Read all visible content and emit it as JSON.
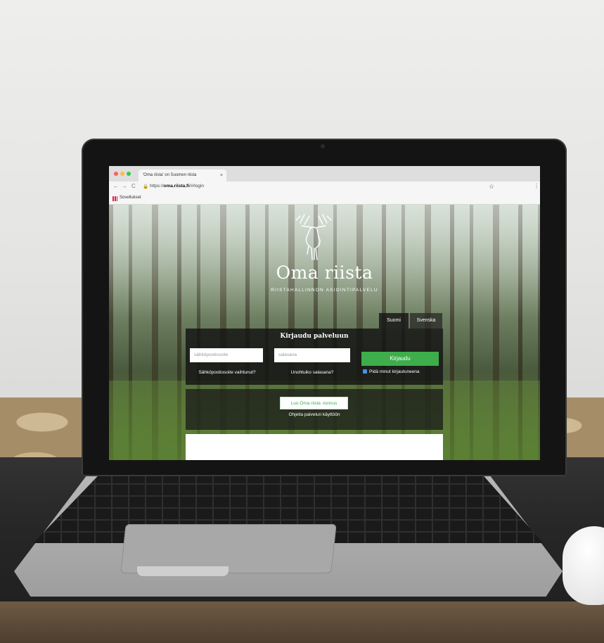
{
  "browser": {
    "tab_title": "'Oma riista' on Suomen riista",
    "tab_close": "×",
    "nav_back": "←",
    "nav_forward": "→",
    "nav_reload": "C",
    "lock": "🔒",
    "url_prefix": "https://",
    "url_domain": "oma.riista.fi",
    "url_path": "/#/login",
    "bookmark_star": "☆",
    "menu": "⋮",
    "bookmarks_label": "Sovellukset"
  },
  "page": {
    "brand": "Oma riista",
    "tagline": "RIISTAHALLINNON ASIOINTIPALVELU",
    "languages": [
      "Suomi",
      "Svenska"
    ],
    "login": {
      "title": "Kirjaudu palveluun",
      "email_placeholder": "sähköpostiosoite",
      "password_placeholder": "salasana",
      "submit": "Kirjaudu",
      "email_changed_link": "Sähköpostiosoite vaihtunut?",
      "forgot_link": "Unohtuiko salasana?",
      "remember_label": "Pidä minut kirjautuneena"
    },
    "register": {
      "button": "Luo Oma riista -tunnus",
      "subtitle": "Ohjeita palvelun käyttöön"
    }
  },
  "colors": {
    "accent_green": "#3dae4b",
    "panel_dark": "#141414"
  }
}
